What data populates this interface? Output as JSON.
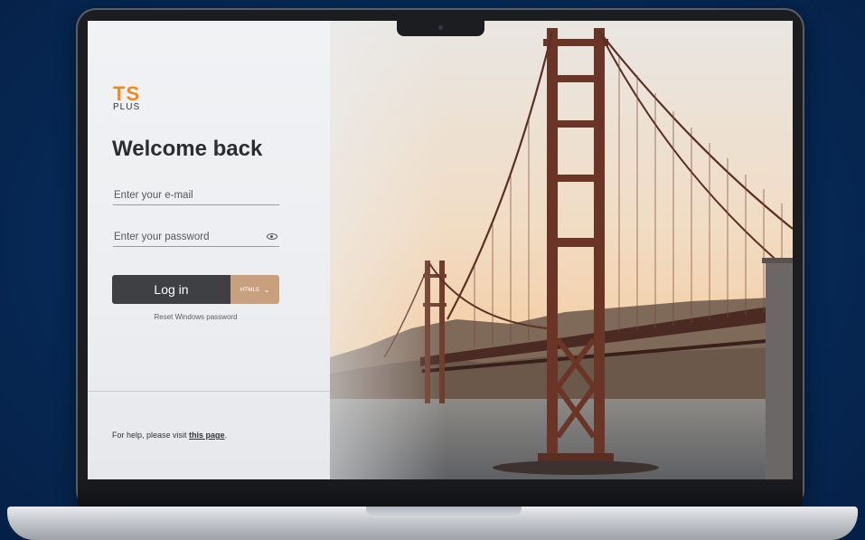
{
  "login": {
    "logo_top": "TS",
    "logo_bottom": "PLUS",
    "title": "Welcome back",
    "email_placeholder": "Enter your e-mail",
    "password_placeholder": "Enter your password",
    "login_label": "Log in",
    "mode_label": "HTML5",
    "reset_label": "Reset Windows password",
    "help_prefix": "For help, please visit ",
    "help_link": "this page",
    "help_suffix": "."
  },
  "colors": {
    "accent": "#f08a1c",
    "button": "#3f4044",
    "mode_button": "#c9a07e",
    "background": "#072a57"
  },
  "icons": {
    "password_toggle": "eye-icon",
    "mode_dropdown": "chevron-down-icon"
  }
}
